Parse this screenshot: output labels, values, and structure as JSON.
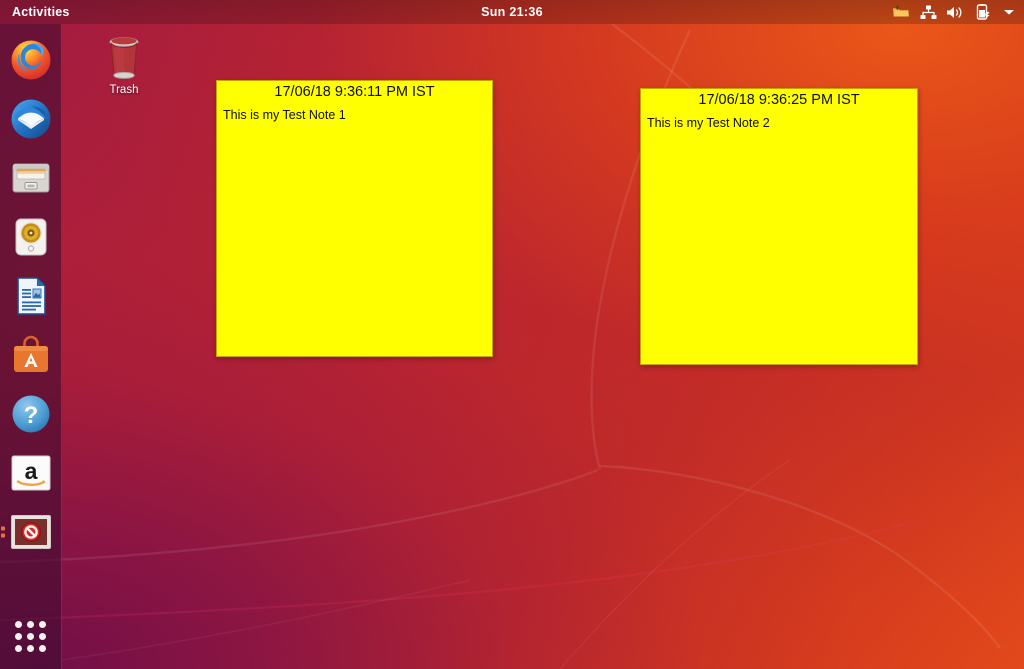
{
  "topbar": {
    "activities_label": "Activities",
    "clock": "Sun 21:36",
    "tray": [
      {
        "name": "folder-indicator-icon",
        "label": "Files indicator"
      },
      {
        "name": "network-icon",
        "label": "Network"
      },
      {
        "name": "volume-icon",
        "label": "Volume"
      },
      {
        "name": "battery-icon",
        "label": "Battery"
      },
      {
        "name": "chevron-down-icon",
        "label": "System menu"
      }
    ]
  },
  "dock": {
    "items": [
      {
        "name": "firefox",
        "label": "Firefox Web Browser",
        "running": false
      },
      {
        "name": "thunderbird",
        "label": "Thunderbird Mail",
        "running": false
      },
      {
        "name": "files",
        "label": "Files",
        "running": false
      },
      {
        "name": "rhythmbox",
        "label": "Rhythmbox",
        "running": false
      },
      {
        "name": "libreoffice-writer",
        "label": "LibreOffice Writer",
        "running": false
      },
      {
        "name": "ubuntu-software",
        "label": "Ubuntu Software",
        "running": false
      },
      {
        "name": "help",
        "label": "Help",
        "running": false
      },
      {
        "name": "amazon",
        "label": "Amazon",
        "running": false
      },
      {
        "name": "xpad-notes",
        "label": "Notes",
        "running": true
      }
    ],
    "show_apps_label": "Show Applications"
  },
  "desktop": {
    "icons": [
      {
        "name": "trash",
        "label": "Trash"
      }
    ]
  },
  "notes": [
    {
      "title": "17/06/18 9:36:11 PM IST",
      "body": "This is my Test Note 1"
    },
    {
      "title": "17/06/18 9:36:25 PM IST",
      "body": "This is my Test Note 2"
    }
  ],
  "colors": {
    "note_background": "#ffff00",
    "note_border": "#c8a400",
    "topbar_text": "#ffffff",
    "accent_orange": "#e8491f",
    "wallpaper_magenta": "#77104a"
  }
}
